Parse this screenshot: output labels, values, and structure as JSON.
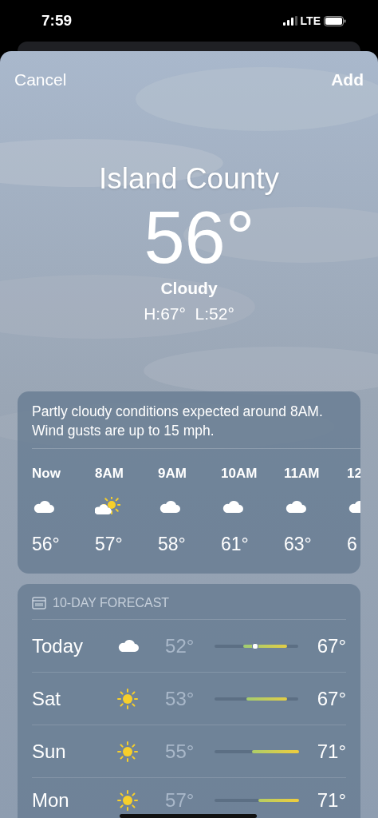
{
  "status_bar": {
    "time": "7:59",
    "network": "LTE"
  },
  "nav": {
    "cancel": "Cancel",
    "add": "Add"
  },
  "location": {
    "name": "Island County",
    "temperature": "56°",
    "condition": "Cloudy",
    "high_low": "H:67°  L:52°"
  },
  "hourly": {
    "summary": "Partly cloudy conditions expected around 8AM. Wind gusts are up to 15 mph.",
    "hours": [
      {
        "time": "Now",
        "kind": "cloud",
        "temp": "56°"
      },
      {
        "time": "8AM",
        "kind": "partly-sunny",
        "temp": "57°"
      },
      {
        "time": "9AM",
        "kind": "cloud",
        "temp": "58°"
      },
      {
        "time": "10AM",
        "kind": "cloud",
        "temp": "61°"
      },
      {
        "time": "11AM",
        "kind": "cloud",
        "temp": "63°"
      },
      {
        "time": "12",
        "kind": "cloud",
        "temp": "6"
      }
    ]
  },
  "forecast": {
    "title": "10-DAY FORECAST",
    "days": [
      {
        "day": "Today",
        "kind": "cloud",
        "low": "52°",
        "high": "67°",
        "now_marker": true
      },
      {
        "day": "Sat",
        "kind": "sun",
        "low": "53°",
        "high": "67°",
        "now_marker": false
      },
      {
        "day": "Sun",
        "kind": "sun",
        "low": "55°",
        "high": "71°",
        "now_marker": false
      },
      {
        "day": "Mon",
        "kind": "sun",
        "low": "57°",
        "high": "71°",
        "now_marker": false
      }
    ]
  }
}
